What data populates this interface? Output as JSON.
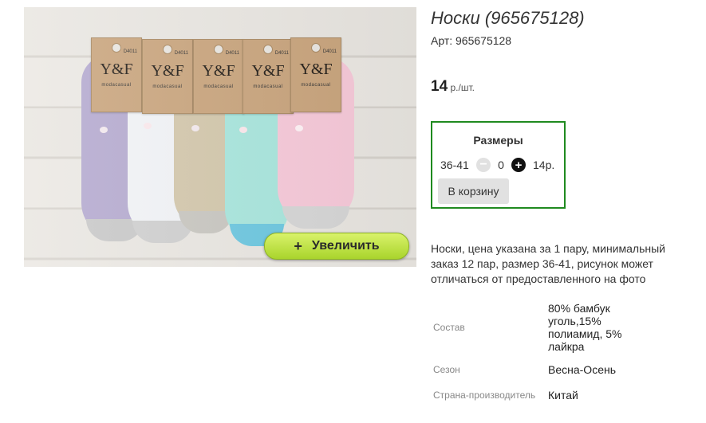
{
  "product": {
    "title": "Носки (965675128)",
    "sku": "Арт: 965675128",
    "price_value": "14",
    "price_unit": " р./шт."
  },
  "photo": {
    "alt": "Носки",
    "tag_brand": "Y&F",
    "tag_code": "D4011",
    "tag_sub": "modacasual",
    "zoom_label": "Увеличить",
    "zoom_icon": "+",
    "sock_colors": [
      "#b4a9cf",
      "#f1f3f6",
      "#d3c7ab",
      "#a8e6dd",
      "#f7c9d9"
    ],
    "sock_cuff_colors": [
      "#c8c8c8",
      "#c9c9c9",
      "#c8c6c0",
      "#6cc7e0",
      "#d6d6d6"
    ]
  },
  "sizes": {
    "title": "Размеры",
    "rows": [
      {
        "label": "36-41",
        "qty": "0",
        "price": "14р."
      }
    ],
    "minus_icon": "−",
    "plus_icon": "+",
    "cart_label": "В корзину",
    "border_color": "#1f8a1f"
  },
  "description": "Носки, цена указана за 1 пару, минимальный заказ 12 пар, размер 36-41, рисунок может отличаться от предоставленного на фото",
  "attributes": [
    {
      "key": "Состав",
      "value": "80% бамбук уголь,15% полиамид, 5% лайкра"
    },
    {
      "key": "Сезон",
      "value": "Весна-Осень"
    },
    {
      "key": "Страна-производитель",
      "value": "Китай"
    }
  ]
}
